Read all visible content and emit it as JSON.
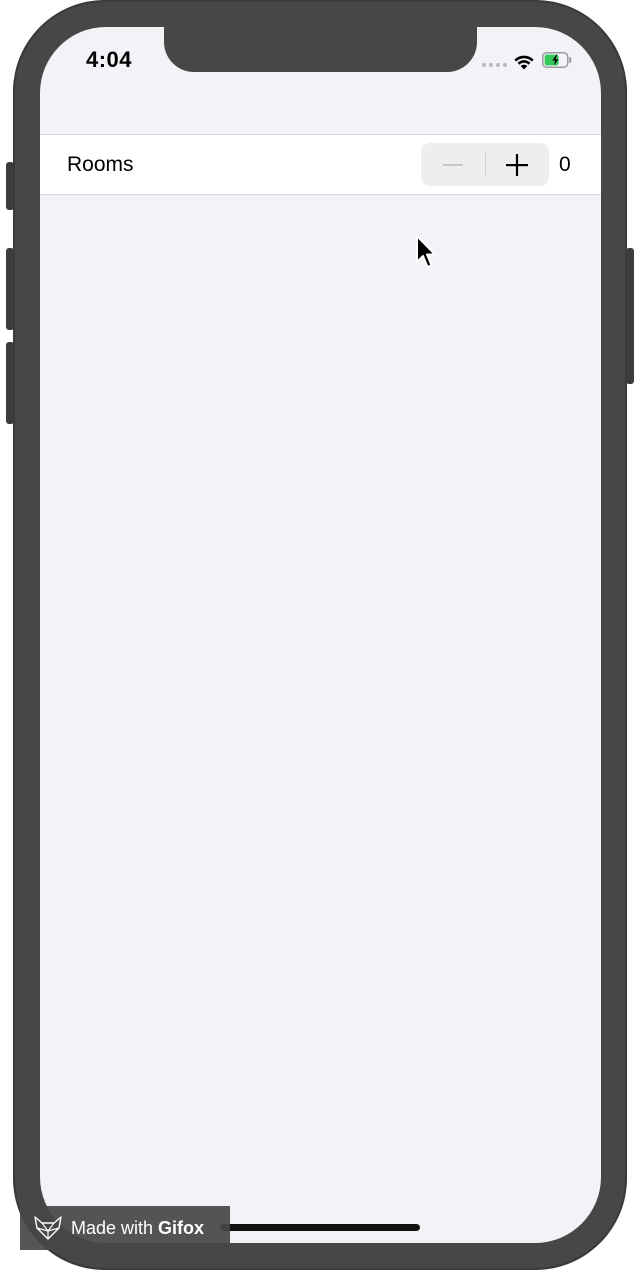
{
  "status_bar": {
    "time": "4:04",
    "wifi_icon": "wifi-icon",
    "battery_icon": "battery-charging-icon",
    "battery_color": "#34c759"
  },
  "rooms_row": {
    "label": "Rooms",
    "decrement_icon": "minus-icon",
    "increment_icon": "plus-icon",
    "value": "0"
  },
  "watermark": {
    "prefix": "Made with",
    "brand": "Gifox",
    "icon": "fox-logo-icon"
  },
  "colors": {
    "screen_background": "#f2f2f7",
    "row_background": "#ffffff",
    "device_frame": "#474747"
  }
}
